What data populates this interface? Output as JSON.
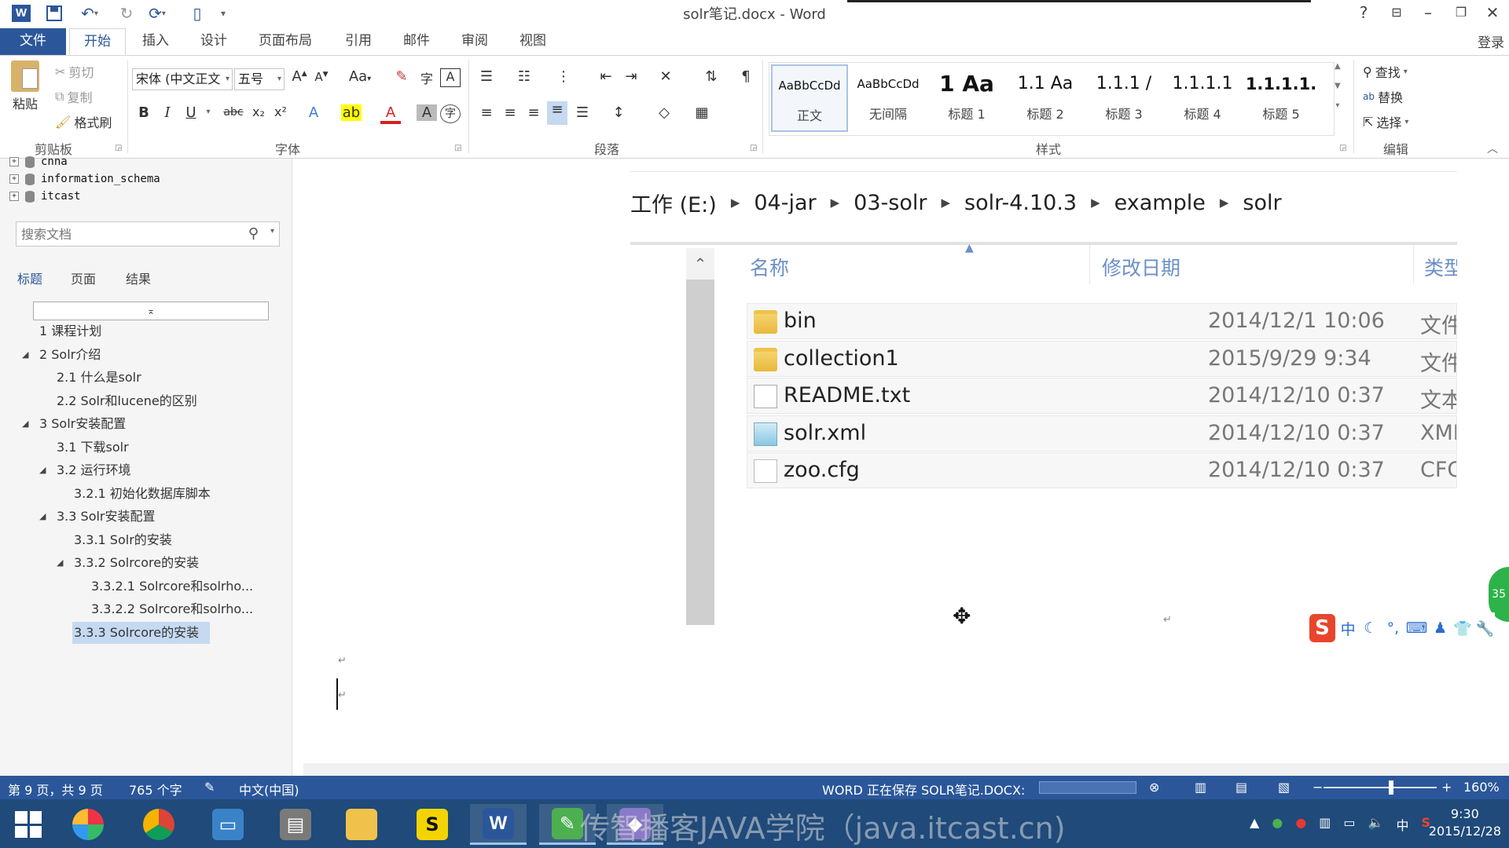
{
  "app": {
    "window_title": "solr笔记.docx - Word",
    "help": "?",
    "login": "登录"
  },
  "ribbon_tabs": [
    "文件",
    "开始",
    "插入",
    "设计",
    "页面布局",
    "引用",
    "邮件",
    "审阅",
    "视图"
  ],
  "ribbon": {
    "clipboard": {
      "paste": "粘贴",
      "cut": "剪切",
      "copy": "复制",
      "format_painter": "格式刷",
      "label": "剪贴板"
    },
    "font": {
      "name": "宋体 (中文正文",
      "size": "五号",
      "label": "字体",
      "case_btn": "Aa"
    },
    "paragraph": {
      "label": "段落"
    },
    "styles": {
      "label": "样式",
      "items": [
        {
          "preview": "AaBbCcDd",
          "name": "正文"
        },
        {
          "preview": "AaBbCcDd",
          "name": "无间隔"
        },
        {
          "preview": "1  Aa",
          "name": "标题 1"
        },
        {
          "preview": "1.1  Aa",
          "name": "标题 2"
        },
        {
          "preview": "1.1.1 /",
          "name": "标题 3"
        },
        {
          "preview": "1.1.1.1",
          "name": "标题 4"
        },
        {
          "preview": "1.1.1.1.",
          "name": "标题 5"
        }
      ]
    },
    "editing": {
      "find": "查找",
      "replace": "替换",
      "select": "选择",
      "label": "编辑"
    }
  },
  "nav": {
    "db_tree": [
      "cnna",
      "information_schema",
      "itcast"
    ],
    "search_placeholder": "搜索文档",
    "tabs": [
      "标题",
      "页面",
      "结果"
    ],
    "collapse_glyph": "⌅",
    "headings": [
      {
        "text": "1 课程计划",
        "level": 1,
        "toggle": ""
      },
      {
        "text": "2 Solr介绍",
        "level": 1,
        "toggle": "◢"
      },
      {
        "text": "2.1 什么是solr",
        "level": 2,
        "toggle": ""
      },
      {
        "text": "2.2 Solr和lucene的区别",
        "level": 2,
        "toggle": ""
      },
      {
        "text": "3 Solr安装配置",
        "level": 1,
        "toggle": "◢"
      },
      {
        "text": "3.1 下载solr",
        "level": 2,
        "toggle": ""
      },
      {
        "text": "3.2 运行环境",
        "level": 2,
        "toggle": "◢"
      },
      {
        "text": "3.2.1 初始化数据库脚本",
        "level": 3,
        "toggle": ""
      },
      {
        "text": "3.3 Solr安装配置",
        "level": 2,
        "toggle": "◢"
      },
      {
        "text": "3.3.1 Solr的安装",
        "level": 3,
        "toggle": ""
      },
      {
        "text": "3.3.2 Solrcore的安装",
        "level": 3,
        "toggle": "◢"
      },
      {
        "text": "3.3.2.1 Solrcore和solrho...",
        "level": 4,
        "toggle": ""
      },
      {
        "text": "3.3.2.2 Solrcore和solrho...",
        "level": 4,
        "toggle": ""
      },
      {
        "text": "3.3.3 Solrcore的安装",
        "level": 3,
        "toggle": "",
        "selected": true
      }
    ]
  },
  "explorer": {
    "breadcrumb": [
      "工作 (E:)",
      "04-jar",
      "03-solr",
      "solr-4.10.3",
      "example",
      "solr"
    ],
    "columns": [
      "名称",
      "修改日期",
      "类型"
    ],
    "files": [
      {
        "name": "bin",
        "date": "2014/12/1 10:06",
        "type": "文件",
        "icon": "folder-icon"
      },
      {
        "name": "collection1",
        "date": "2015/9/29 9:34",
        "type": "文件",
        "icon": "folder-icon"
      },
      {
        "name": "README.txt",
        "date": "2014/12/10 0:37",
        "type": "文本",
        "icon": "text-file-icon"
      },
      {
        "name": "solr.xml",
        "date": "2014/12/10 0:37",
        "type": "XML",
        "icon": "xml-file-icon"
      },
      {
        "name": "zoo.cfg",
        "date": "2014/12/10 0:37",
        "type": "CFG",
        "icon": "file-icon"
      }
    ]
  },
  "badge_text": "35",
  "ime": {
    "logo": "S",
    "lang": "中"
  },
  "status": {
    "page": "第 9 页，共 9 页",
    "words": "765 个字",
    "language": "中文(中国)",
    "saving": "WORD 正在保存 SOLR笔记.DOCX:",
    "zoom": "160%",
    "zoom_fraction": 0.6
  },
  "taskbar": {
    "watermark": "传智播客JAVA学院（java.itcast.cn)",
    "time": "9:30",
    "date": "2015/12/28",
    "tray_lang": "中"
  },
  "colors": {
    "accent": "#2b579a",
    "folder": "#e8b83a",
    "sogou": "#e8452c"
  }
}
